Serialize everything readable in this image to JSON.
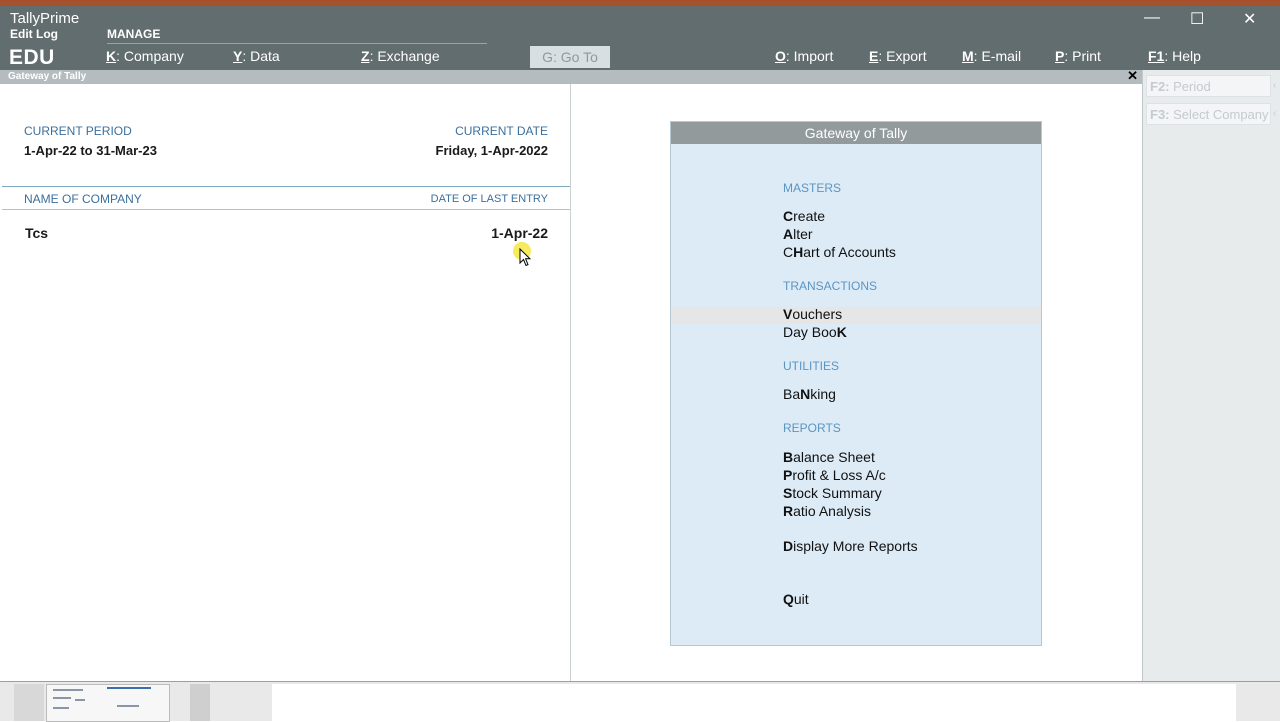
{
  "app": {
    "name": "TallyPrime",
    "edit_log": "Edit Log",
    "edition": "EDU",
    "manage": "MANAGE"
  },
  "menu": [
    {
      "key": "K",
      "label": "Company"
    },
    {
      "key": "Y",
      "label": "Data"
    },
    {
      "key": "Z",
      "label": "Exchange"
    },
    {
      "key": "G",
      "label": "Go To"
    },
    {
      "key": "O",
      "label": "Import"
    },
    {
      "key": "E",
      "label": "Export"
    },
    {
      "key": "M",
      "label": "E-mail"
    },
    {
      "key": "P",
      "label": "Print"
    },
    {
      "key": "F1",
      "label": "Help"
    }
  ],
  "window_controls": {
    "minimize": "—",
    "maximize": "☐",
    "close": "✕"
  },
  "breadcrumb": {
    "title": "Gateway of Tally",
    "close": "✕"
  },
  "left": {
    "current_period_label": "CURRENT PERIOD",
    "current_period_value": "1-Apr-22 to 31-Mar-23",
    "current_date_label": "CURRENT DATE",
    "current_date_value": "Friday, 1-Apr-2022",
    "company_col": "NAME OF COMPANY",
    "last_entry_col": "DATE OF LAST ENTRY",
    "company_name": "Tcs",
    "last_entry": "1-Apr-22"
  },
  "gateway": {
    "title": "Gateway of Tally",
    "masters": "MASTERS",
    "transactions": "TRANSACTIONS",
    "utilities": "UTILITIES",
    "reports": "REPORTS",
    "items": {
      "create": {
        "pre": "",
        "key": "C",
        "post": "reate"
      },
      "alter": {
        "pre": "",
        "key": "A",
        "post": "lter"
      },
      "chart": {
        "pre": "C",
        "key": "H",
        "post": "art of Accounts"
      },
      "vouchers": {
        "pre": "",
        "key": "V",
        "post": "ouchers"
      },
      "daybook": {
        "pre": "Day Boo",
        "key": "K",
        "post": ""
      },
      "banking": {
        "pre": "Ba",
        "key": "N",
        "post": "king"
      },
      "balance": {
        "pre": "",
        "key": "B",
        "post": "alance Sheet"
      },
      "profit": {
        "pre": "",
        "key": "P",
        "post": "rofit & Loss A/c"
      },
      "stock": {
        "pre": "",
        "key": "S",
        "post": "tock Summary"
      },
      "ratio": {
        "pre": "",
        "key": "R",
        "post": "atio Analysis"
      },
      "display": {
        "pre": "",
        "key": "D",
        "post": "isplay More Reports"
      },
      "quit": {
        "pre": "",
        "key": "Q",
        "post": "uit"
      }
    }
  },
  "side": {
    "f2_key": "F2:",
    "f2_label": "Period",
    "f3_key": "F3:",
    "f3_label": "Select Company",
    "arrow": "‹"
  },
  "colors": {
    "header": "#626d6f",
    "accent_strip": "#a5512d",
    "gateway_bg": "#ddebf6",
    "section_label": "#5b95c2"
  }
}
